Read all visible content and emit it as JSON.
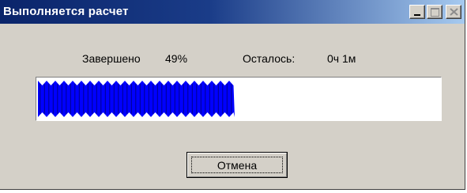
{
  "window": {
    "title": "Выполняется расчет",
    "buttons": {
      "minimize_icon": "minimize-icon",
      "maximize_icon": "maximize-icon",
      "close_icon": "close-icon"
    }
  },
  "status": {
    "completed_label": "Завершено",
    "completed_value": "49%",
    "remaining_label": "Осталось:",
    "remaining_value": "0ч 1м"
  },
  "progress": {
    "fraction": 0.49,
    "fill_color": "#0000ff",
    "track_color": "#ffffff"
  },
  "actions": {
    "cancel_label": "Отмена"
  },
  "colors": {
    "titlebar_start": "#0a246a",
    "titlebar_end": "#a6caf0",
    "dialog_background": "#d4d0c8"
  }
}
